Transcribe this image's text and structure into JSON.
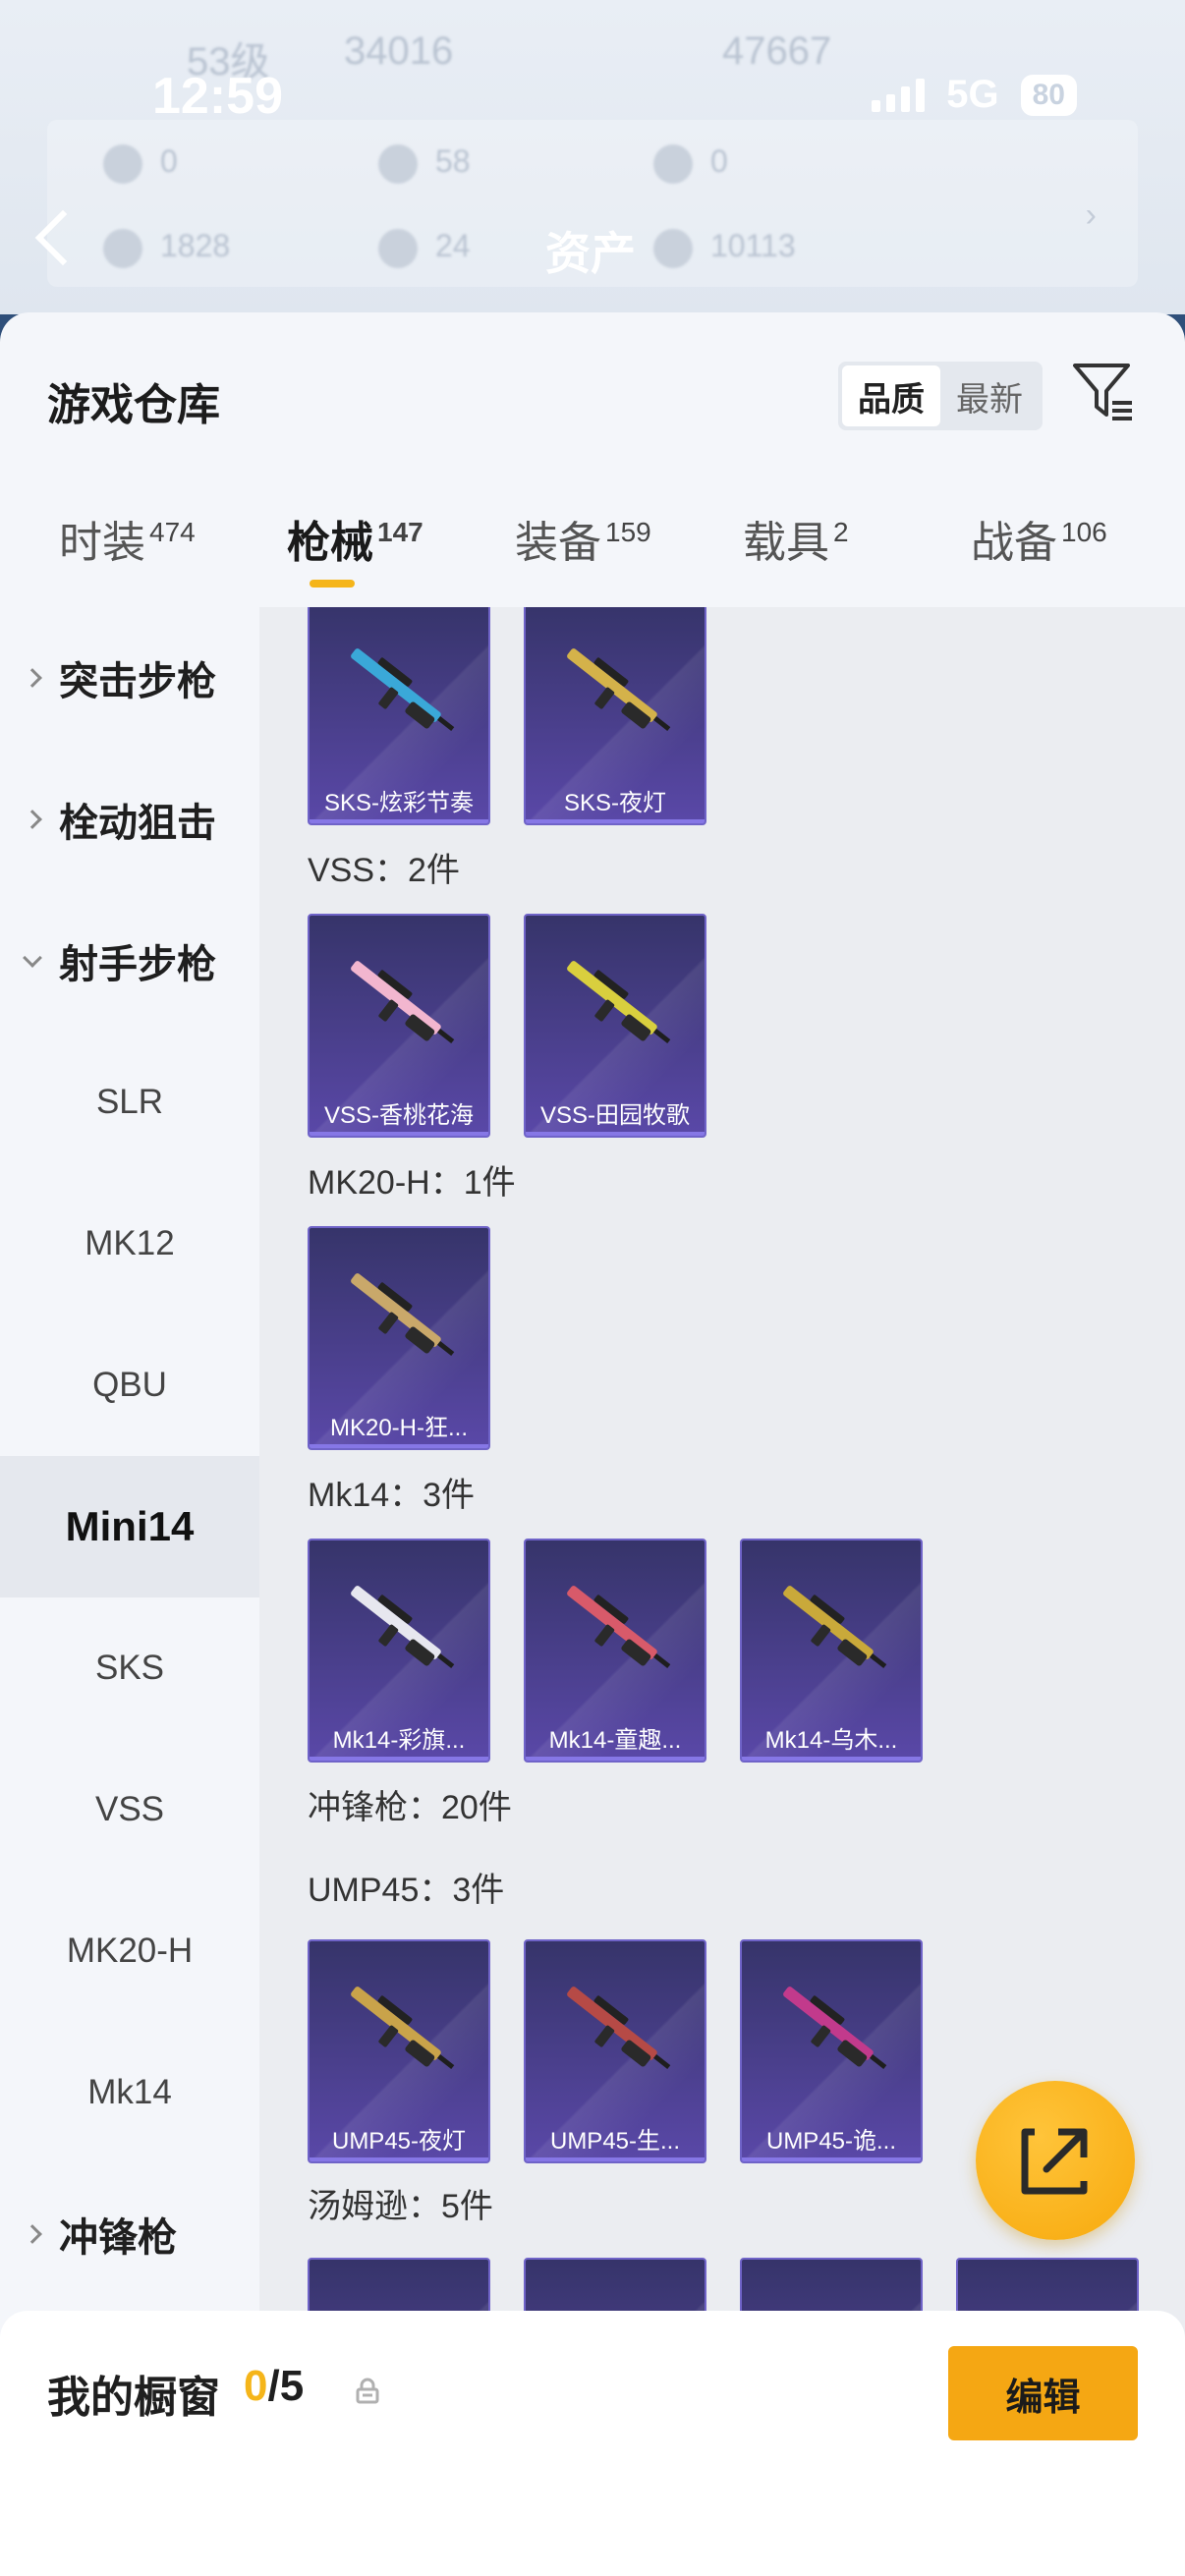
{
  "status": {
    "time": "12:59",
    "network": "5G",
    "battery": "80"
  },
  "background": {
    "title": "资产",
    "row1": {
      "level": "53级",
      "coins": "34016",
      "points": "47667"
    },
    "row2": [
      "0",
      "58",
      "0"
    ],
    "row3": [
      "1828",
      "24",
      "10113"
    ]
  },
  "header": {
    "title": "游戏仓库",
    "sort_quality": "品质",
    "sort_latest": "最新"
  },
  "tabs": [
    {
      "label": "时装",
      "count": "474"
    },
    {
      "label": "枪械",
      "count": "147"
    },
    {
      "label": "装备",
      "count": "159"
    },
    {
      "label": "载具",
      "count": "2"
    },
    {
      "label": "战备",
      "count": "106"
    }
  ],
  "sidebar": {
    "items": [
      "突击步枪",
      "栓动狙击",
      "射手步枪",
      "SLR",
      "MK12",
      "QBU",
      "Mini14",
      "SKS",
      "VSS",
      "MK20-H",
      "Mk14",
      "冲锋枪"
    ]
  },
  "content": {
    "groups": [
      {
        "label": "VSS：2件"
      },
      {
        "label": "MK20-H：1件"
      },
      {
        "label": "Mk14：3件"
      },
      {
        "label": "冲锋枪：20件"
      },
      {
        "label": "UMP45：3件"
      },
      {
        "label": "汤姆逊：5件"
      }
    ],
    "cards": [
      {
        "name": "SKS-炫彩节奏",
        "color": "#3aa8d8"
      },
      {
        "name": "SKS-夜灯",
        "color": "#d4b24a"
      },
      {
        "name": "VSS-香桃花海",
        "color": "#f2b6cf"
      },
      {
        "name": "VSS-田园牧歌",
        "color": "#d9cf3e"
      },
      {
        "name": "MK20-H-狂...",
        "color": "#c9a86a"
      },
      {
        "name": "Mk14-彩旗...",
        "color": "#e7e7ef"
      },
      {
        "name": "Mk14-童趣...",
        "color": "#d85a6a"
      },
      {
        "name": "Mk14-乌木...",
        "color": "#c9a93a"
      },
      {
        "name": "UMP45-夜灯",
        "color": "#c9a34a"
      },
      {
        "name": "UMP45-生...",
        "color": "#b64a46"
      },
      {
        "name": "UMP45-诡...",
        "color": "#c23a8c"
      }
    ]
  },
  "bottom": {
    "label": "我的橱窗",
    "current": "0",
    "total": "/5",
    "edit": "编辑"
  },
  "colors": {
    "accent": "#f5b51a",
    "card_bg": "#4a3f8c"
  }
}
